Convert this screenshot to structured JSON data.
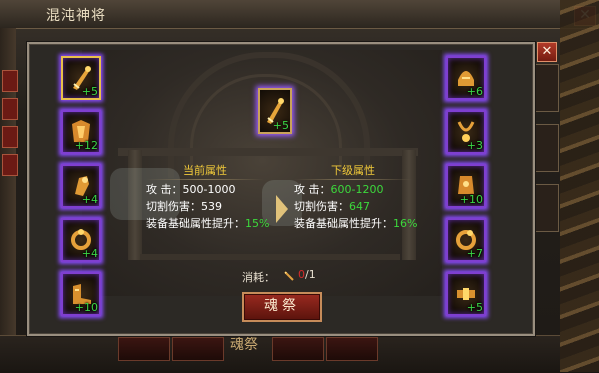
{
  "window": {
    "title": "混沌神将",
    "close_glyph": "✕"
  },
  "popup": {
    "close_glyph": "✕"
  },
  "background_button_text": "魂祭",
  "left_slots": [
    {
      "level": "+5"
    },
    {
      "level": "+12"
    },
    {
      "level": "+4"
    },
    {
      "level": "+4"
    },
    {
      "level": "+10"
    }
  ],
  "right_slots": [
    {
      "level": "+6"
    },
    {
      "level": "+3"
    },
    {
      "level": "+10"
    },
    {
      "level": "+7"
    },
    {
      "level": "+5"
    }
  ],
  "selected_item": {
    "level": "+5"
  },
  "current": {
    "header": "当前属性",
    "attack_label": "攻  击：",
    "attack_value": "500-1000",
    "cut_label": "切割伤害：",
    "cut_value": "539",
    "boost_label": "装备基础属性提升：",
    "boost_value": "15%"
  },
  "next": {
    "header": "下级属性",
    "attack_label": "攻  击：",
    "attack_value": "600-1200",
    "cut_label": "切割伤害：",
    "cut_value": "647",
    "boost_label": "装备基础属性提升：",
    "boost_value": "16%"
  },
  "cost": {
    "label": "消耗：",
    "have": "0",
    "need": "/1"
  },
  "action_button": "魂祭",
  "colors": {
    "level_text": "#3bd646",
    "header": "#f0c93a",
    "upgrade_value": "#3cd83c",
    "insufficient": "#d42a2a",
    "slot_glow": "#8a4bff"
  },
  "icons": {
    "weapon": "sword-icon",
    "arrow": "arrow-right-icon",
    "cost": "sword-shard-icon"
  }
}
